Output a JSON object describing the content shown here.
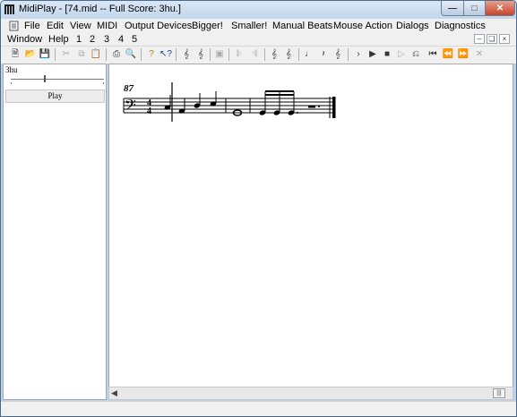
{
  "window": {
    "title": "MidiPlay - [74.mid -- Full Score: 3hu.]"
  },
  "menu": {
    "row1": [
      "File",
      "Edit",
      "View",
      "MIDI",
      "Output Devices",
      "Bigger!",
      "Smaller!",
      "Manual Beats",
      "Mouse Action",
      "Dialogs",
      "Diagnostics"
    ],
    "row2": [
      "Window",
      "Help",
      "1",
      "2",
      "3",
      "4",
      "5"
    ]
  },
  "toolbar": {
    "icons": [
      "new-icon",
      "open-icon",
      "save-icon",
      "cut-icon",
      "copy-icon",
      "paste-icon",
      "print-icon",
      "print-preview-icon",
      "help-icon",
      "context-help-icon",
      "score-icon",
      "parts-icon",
      "window-icon",
      "repeat-icon",
      "repeat-alt-icon",
      "tempo-icon",
      "tempo-alt-icon",
      "note-icon",
      "rest-icon",
      "treble-icon",
      "play-icon",
      "play-from-icon",
      "stop-icon",
      "step-icon",
      "loop-icon",
      "go-start-icon",
      "rewind-icon",
      "fast-forward-icon",
      "close-icon"
    ]
  },
  "left_panel": {
    "score_name": "3hu",
    "play_label": "Play",
    "slider_position": 0.36
  },
  "score": {
    "measure_number": "87",
    "clef": "bass-clef-icon",
    "time_signature": {
      "top": "4",
      "bottom": "4"
    }
  }
}
